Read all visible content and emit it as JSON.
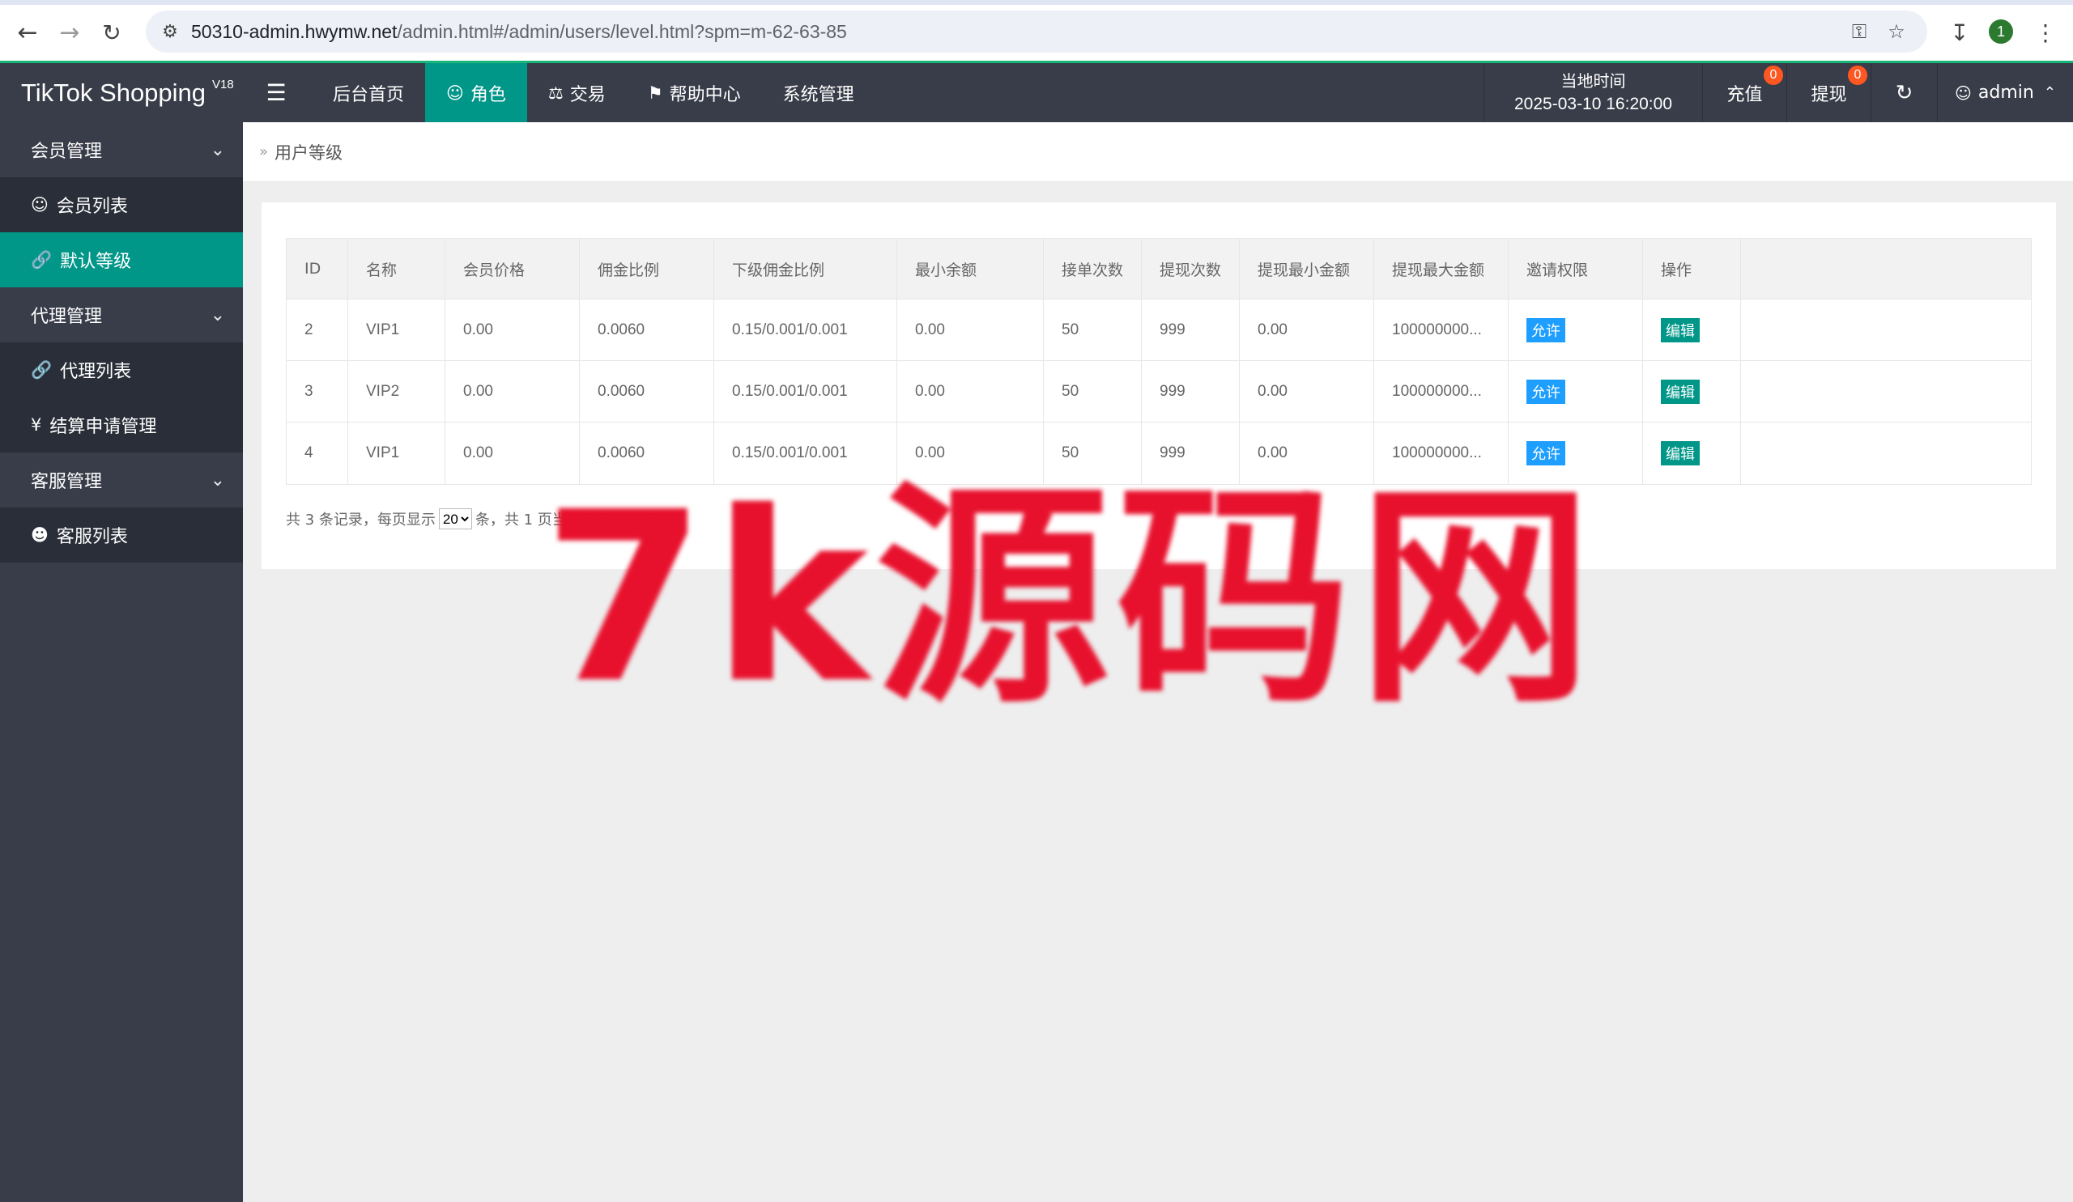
{
  "browser": {
    "url_host": "50310-admin.hwymw.net",
    "url_path": "/admin.html#/admin/users/level.html?spm=m-62-63-85",
    "profile_initial": "1"
  },
  "header": {
    "logo": "TikTok Shopping",
    "version": "V18",
    "nav": [
      {
        "label": "后台首页"
      },
      {
        "label": "角色"
      },
      {
        "label": "交易"
      },
      {
        "label": "帮助中心"
      },
      {
        "label": "系统管理"
      }
    ],
    "time_label": "当地时间",
    "time_value": "2025-03-10 16:20:00",
    "recharge_label": "充值",
    "recharge_count": "0",
    "withdraw_label": "提现",
    "withdraw_count": "0",
    "user": "admin"
  },
  "sidebar": {
    "groups": [
      {
        "label": "会员管理",
        "items": [
          {
            "label": "会员列表"
          },
          {
            "label": "默认等级"
          }
        ]
      },
      {
        "label": "代理管理",
        "items": [
          {
            "label": "代理列表"
          },
          {
            "label": "结算申请管理"
          }
        ]
      },
      {
        "label": "客服管理",
        "items": [
          {
            "label": "客服列表"
          }
        ]
      }
    ]
  },
  "breadcrumb": "用户等级",
  "table": {
    "headers": [
      "ID",
      "名称",
      "会员价格",
      "佣金比例",
      "下级佣金比例",
      "最小余额",
      "接单次数",
      "提现次数",
      "提现最小金额",
      "提现最大金额",
      "邀请权限",
      "操作"
    ],
    "rows": [
      [
        "2",
        "VIP1",
        "0.00",
        "0.0060",
        "0.15/0.001/0.001",
        "0.00",
        "50",
        "999",
        "0.00",
        "100000000...",
        "允许",
        "编辑"
      ],
      [
        "3",
        "VIP2",
        "0.00",
        "0.0060",
        "0.15/0.001/0.001",
        "0.00",
        "50",
        "999",
        "0.00",
        "100000000...",
        "允许",
        "编辑"
      ],
      [
        "4",
        "VIP1",
        "0.00",
        "0.0060",
        "0.15/0.001/0.001",
        "0.00",
        "50",
        "999",
        "0.00",
        "100000000...",
        "允许",
        "编辑"
      ]
    ]
  },
  "pager": {
    "prefix": "共 3 条记录，每页显示",
    "page_size": "20",
    "suffix": "条，共 1 页当前显示第 1 页。"
  },
  "watermark": "7k源码网",
  "colors": {
    "header_bg": "#393d49",
    "accent": "#009688",
    "allow_tag": "#1e9fff",
    "badge": "#ff5722",
    "watermark": "#e8112d"
  }
}
